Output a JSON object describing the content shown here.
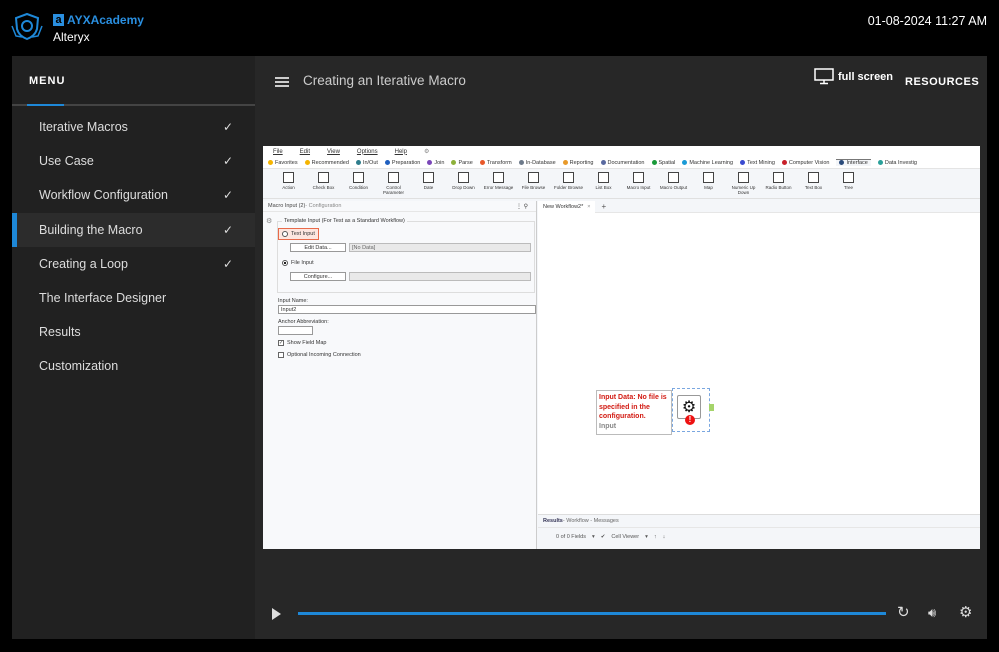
{
  "header": {
    "brand": "AYXAcademy",
    "brand_letter": "a",
    "org": "Alteryx",
    "datetime": "01-08-2024 11:27 AM",
    "logo_icon": "academy-shield-icon"
  },
  "sidebar": {
    "title": "MENU",
    "items": [
      {
        "label": "Iterative Macros",
        "completed": true
      },
      {
        "label": "Use Case",
        "completed": true
      },
      {
        "label": "Workflow Configuration",
        "completed": true
      },
      {
        "label": "Building the Macro",
        "completed": true,
        "active": true
      },
      {
        "label": "Creating a Loop",
        "completed": true
      },
      {
        "label": "The Interface Designer",
        "completed": false
      },
      {
        "label": "Results",
        "completed": false
      },
      {
        "label": "Customization",
        "completed": false
      }
    ],
    "check_glyph": "✓"
  },
  "main": {
    "title": "Creating an Iterative Macro",
    "fullscreen_label": "full screen",
    "resources_label": "RESOURCES"
  },
  "app": {
    "menu": [
      "File",
      "Edit",
      "View",
      "Options",
      "Help"
    ],
    "categories": [
      {
        "label": "Favorites",
        "color": "#f5b400"
      },
      {
        "label": "Recommended",
        "color": "#f5b400"
      },
      {
        "label": "In/Out",
        "color": "#2e7d8c"
      },
      {
        "label": "Preparation",
        "color": "#1f5fbf"
      },
      {
        "label": "Join",
        "color": "#7a46b8"
      },
      {
        "label": "Parse",
        "color": "#8db03a"
      },
      {
        "label": "Transform",
        "color": "#e8582a"
      },
      {
        "label": "In-Database",
        "color": "#6d7a8a"
      },
      {
        "label": "Reporting",
        "color": "#e89a2a"
      },
      {
        "label": "Documentation",
        "color": "#5a6aa0"
      },
      {
        "label": "Spatial",
        "color": "#1a9a3a"
      },
      {
        "label": "Machine Learning",
        "color": "#1a9ad6"
      },
      {
        "label": "Text Mining",
        "color": "#3a4ad0"
      },
      {
        "label": "Computer Vision",
        "color": "#c8202a"
      },
      {
        "label": "Interface",
        "color": "#2a4a7a",
        "selected": true
      },
      {
        "label": "Data Investig",
        "color": "#2aa09a"
      }
    ],
    "tools": [
      "Action",
      "Check Box",
      "Condition",
      "Control Parameter",
      "Date",
      "Drop Down",
      "Error Message",
      "File Browse",
      "Folder Browse",
      "List Box",
      "Macro Input",
      "Macro Output",
      "Map",
      "Numeric Up Down",
      "Radio Button",
      "Text Box",
      "Tree"
    ],
    "config": {
      "header": "Macro Input (2)",
      "header_suffix": " - Configuration",
      "template_legend": "Template Input (For Test as a Standard Workflow)",
      "text_input_label": "Text Input",
      "edit_data_label": "Edit Data...",
      "no_data_value": "[No Data]",
      "file_input_label": "File Input",
      "configure_label": "Configure...",
      "file_value": "",
      "input_name_label": "Input Name:",
      "input_name_value": "Input2",
      "anchor_label": "Anchor Abbreviation:",
      "anchor_value": "",
      "show_field_map_label": "Show Field Map",
      "show_field_map_checked": true,
      "optional_conn_label": "Optional Incoming Connection",
      "optional_conn_checked": false,
      "selected_template": "File Input"
    },
    "canvas": {
      "tab_label": "New Workflow2*",
      "error_text": "Input Data: No file is specified in the configuration.",
      "node_label": "Input"
    },
    "results": {
      "title": "Results",
      "breadcrumb": " - Workflow - Messages",
      "fields": "0 of 0 Fields",
      "cell_viewer": "Cell Viewer"
    }
  },
  "player": {
    "progress": 1.0,
    "accent": "#1e88d8"
  }
}
